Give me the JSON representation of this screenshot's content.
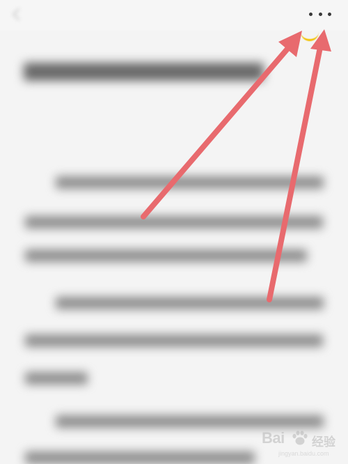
{
  "topbar": {
    "back_icon": "back-icon",
    "more_icon": "more-horizontal-icon",
    "more_label": "• • •"
  },
  "highlight": {
    "color": "#f2c200"
  },
  "annotation": {
    "arrow_color": "#e86a6e",
    "arrow_count": 2
  },
  "watermark": {
    "brand": "Bai",
    "label": "经验",
    "url": "jingyan.baidu.com"
  }
}
